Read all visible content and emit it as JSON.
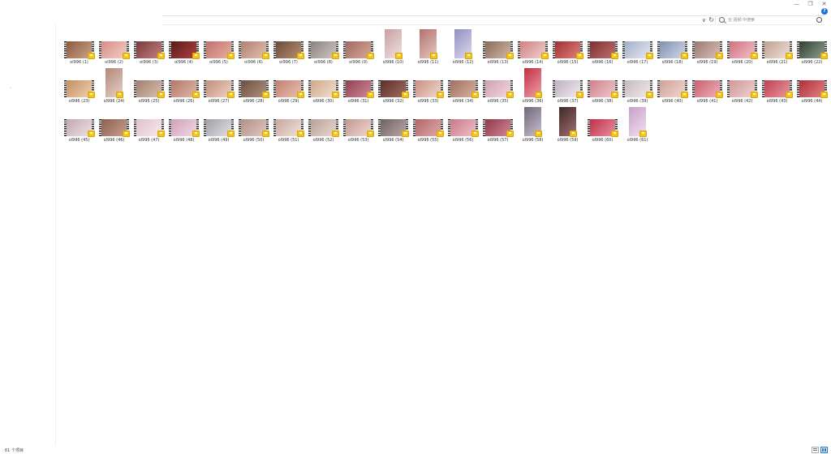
{
  "window": {
    "controls": [
      "minimize-icon",
      "maximize-icon",
      "close-icon"
    ],
    "minimize_glyph": "—",
    "maximize_glyph": "❐",
    "close_glyph": "✕",
    "help_glyph": "?"
  },
  "address_bar": {
    "chevron_glyph": "∨",
    "refresh_glyph": "↻",
    "search_placeholder": "在 视频 中搜索"
  },
  "files": [
    {
      "name": "ol996 (1)",
      "orientation": "landscape",
      "palette": [
        "#8b5a3c",
        "#c9a58a"
      ]
    },
    {
      "name": "ol996 (2)",
      "orientation": "landscape",
      "palette": [
        "#d98c8c",
        "#f0d0c0"
      ]
    },
    {
      "name": "ol996 (3)",
      "orientation": "landscape",
      "palette": [
        "#7a3a3a",
        "#c48080"
      ]
    },
    {
      "name": "ol996 (4)",
      "orientation": "landscape",
      "palette": [
        "#5a1a1a",
        "#b04040"
      ]
    },
    {
      "name": "ol996 (5)",
      "orientation": "landscape",
      "palette": [
        "#c07070",
        "#e8b0a0"
      ]
    },
    {
      "name": "ol996 (6)",
      "orientation": "landscape",
      "palette": [
        "#b08070",
        "#e0c0b0"
      ]
    },
    {
      "name": "ol996 (7)",
      "orientation": "landscape",
      "palette": [
        "#6a4a3a",
        "#b89070"
      ]
    },
    {
      "name": "ol996 (8)",
      "orientation": "landscape",
      "palette": [
        "#8a8080",
        "#d0c8c0"
      ]
    },
    {
      "name": "ol996 (9)",
      "orientation": "landscape",
      "palette": [
        "#a06a60",
        "#d8a898"
      ]
    },
    {
      "name": "ol996 (10)",
      "orientation": "portrait",
      "palette": [
        "#c8a0a0",
        "#f0e0e0"
      ]
    },
    {
      "name": "ol996 (11)",
      "orientation": "portrait",
      "palette": [
        "#b07070",
        "#e8c8c0"
      ]
    },
    {
      "name": "ol996 (12)",
      "orientation": "portrait",
      "palette": [
        "#9090c0",
        "#e0d8f0"
      ]
    },
    {
      "name": "ol996 (13)",
      "orientation": "landscape",
      "palette": [
        "#8a6a5a",
        "#d0b8a8"
      ]
    },
    {
      "name": "ol996 (14)",
      "orientation": "landscape",
      "palette": [
        "#d08080",
        "#f0d0d0"
      ]
    },
    {
      "name": "ol996 (15)",
      "orientation": "landscape",
      "palette": [
        "#a03030",
        "#e08080"
      ]
    },
    {
      "name": "ol996 (16)",
      "orientation": "landscape",
      "palette": [
        "#7a3030",
        "#c07070"
      ]
    },
    {
      "name": "ol996 (17)",
      "orientation": "landscape",
      "palette": [
        "#a0b0c8",
        "#e8e8f0"
      ]
    },
    {
      "name": "ol996 (18)",
      "orientation": "landscape",
      "palette": [
        "#8090b0",
        "#d0d8e8"
      ]
    },
    {
      "name": "ol996 (19)",
      "orientation": "landscape",
      "palette": [
        "#9a7a70",
        "#d8c0b8"
      ]
    },
    {
      "name": "ol996 (20)",
      "orientation": "landscape",
      "palette": [
        "#d07080",
        "#f0c0c8"
      ]
    },
    {
      "name": "ol996 (21)",
      "orientation": "landscape",
      "palette": [
        "#c0a090",
        "#f0e0d8"
      ]
    },
    {
      "name": "ol996 (22)",
      "orientation": "landscape",
      "palette": [
        "#304030",
        "#90a090"
      ]
    },
    {
      "name": "ol996 (23)",
      "orientation": "landscape",
      "palette": [
        "#c09060",
        "#f0d0b0"
      ]
    },
    {
      "name": "ol996 (24)",
      "orientation": "portrait",
      "palette": [
        "#b08878",
        "#e8d0c8"
      ]
    },
    {
      "name": "ol996 (25)",
      "orientation": "landscape",
      "palette": [
        "#a08070",
        "#d8c0b0"
      ]
    },
    {
      "name": "ol996 (26)",
      "orientation": "landscape",
      "palette": [
        "#b07868",
        "#e0b8a8"
      ]
    },
    {
      "name": "ol996 (27)",
      "orientation": "landscape",
      "palette": [
        "#c09080",
        "#f0d0c0"
      ]
    },
    {
      "name": "ol996 (28)",
      "orientation": "landscape",
      "palette": [
        "#6a5040",
        "#b09080"
      ]
    },
    {
      "name": "ol996 (29)",
      "orientation": "landscape",
      "palette": [
        "#c08070",
        "#e8c0b0"
      ]
    },
    {
      "name": "ol996 (30)",
      "orientation": "landscape",
      "palette": [
        "#d0a888",
        "#f0e0d0"
      ]
    },
    {
      "name": "ol996 (31)",
      "orientation": "landscape",
      "palette": [
        "#904050",
        "#d08898"
      ]
    },
    {
      "name": "ol996 (32)",
      "orientation": "landscape",
      "palette": [
        "#5a3028",
        "#a06a60"
      ]
    },
    {
      "name": "ol996 (33)",
      "orientation": "landscape",
      "palette": [
        "#c89080",
        "#f0d8d0"
      ]
    },
    {
      "name": "ol996 (34)",
      "orientation": "landscape",
      "palette": [
        "#a07060",
        "#d8b0a0"
      ]
    },
    {
      "name": "ol996 (35)",
      "orientation": "landscape",
      "palette": [
        "#d0a0b0",
        "#f0d8e0"
      ]
    },
    {
      "name": "ol996 (36)",
      "orientation": "portrait",
      "palette": [
        "#c03040",
        "#f0a0b0"
      ]
    },
    {
      "name": "ol996 (37)",
      "orientation": "landscape",
      "palette": [
        "#c0b0c0",
        "#f0e8f0"
      ]
    },
    {
      "name": "ol996 (38)",
      "orientation": "landscape",
      "palette": [
        "#d08088",
        "#f0c8d0"
      ]
    },
    {
      "name": "ol996 (39)",
      "orientation": "landscape",
      "palette": [
        "#c8b8c0",
        "#f0e8ec"
      ]
    },
    {
      "name": "ol996 (40)",
      "orientation": "landscape",
      "palette": [
        "#d0a098",
        "#f0d8d0"
      ]
    },
    {
      "name": "ol996 (41)",
      "orientation": "landscape",
      "palette": [
        "#c86070",
        "#f0b0b8"
      ]
    },
    {
      "name": "ol996 (42)",
      "orientation": "landscape",
      "palette": [
        "#d09898",
        "#f0d0d0"
      ]
    },
    {
      "name": "ol996 (43)",
      "orientation": "landscape",
      "palette": [
        "#c04050",
        "#e898a0"
      ]
    },
    {
      "name": "ol996 (44)",
      "orientation": "landscape",
      "palette": [
        "#b03038",
        "#e08088"
      ]
    },
    {
      "name": "ol996 (45)",
      "orientation": "landscape",
      "palette": [
        "#c0a8b0",
        "#f0e0e8"
      ]
    },
    {
      "name": "ol996 (46)",
      "orientation": "landscape",
      "palette": [
        "#8a6050",
        "#c8a090"
      ]
    },
    {
      "name": "ol996 (47)",
      "orientation": "landscape",
      "palette": [
        "#e0c0c8",
        "#f8eaee"
      ]
    },
    {
      "name": "ol996 (48)",
      "orientation": "landscape",
      "palette": [
        "#d0a0b8",
        "#f0d8e4"
      ]
    },
    {
      "name": "ol996 (49)",
      "orientation": "landscape",
      "palette": [
        "#a0a0a8",
        "#e0e0e4"
      ]
    },
    {
      "name": "ol996 (50)",
      "orientation": "landscape",
      "palette": [
        "#b09088",
        "#e0c8c0"
      ]
    },
    {
      "name": "ol996 (51)",
      "orientation": "landscape",
      "palette": [
        "#c8a8a0",
        "#f0e0d8"
      ]
    },
    {
      "name": "ol996 (52)",
      "orientation": "landscape",
      "palette": [
        "#b8a098",
        "#e8d8d0"
      ]
    },
    {
      "name": "ol996 (53)",
      "orientation": "landscape",
      "palette": [
        "#c09890",
        "#f0d8d0"
      ]
    },
    {
      "name": "ol996 (54)",
      "orientation": "landscape",
      "palette": [
        "#706060",
        "#b8a8a8"
      ]
    },
    {
      "name": "ol996 (55)",
      "orientation": "landscape",
      "palette": [
        "#b06868",
        "#e0a8a8"
      ]
    },
    {
      "name": "ol996 (56)",
      "orientation": "landscape",
      "palette": [
        "#c87888",
        "#f0c0c8"
      ]
    },
    {
      "name": "ol996 (57)",
      "orientation": "landscape",
      "palette": [
        "#903848",
        "#d08898"
      ]
    },
    {
      "name": "ol996 (58)",
      "orientation": "portrait",
      "palette": [
        "#706878",
        "#c8c0d0"
      ]
    },
    {
      "name": "ol996 (59)",
      "orientation": "portrait",
      "palette": [
        "#402828",
        "#a07070"
      ]
    },
    {
      "name": "ol996 (60)",
      "orientation": "landscape",
      "palette": [
        "#c03048",
        "#e890a0"
      ]
    },
    {
      "name": "ol996 (61)",
      "orientation": "portrait",
      "palette": [
        "#c8a0c8",
        "#f0e0f0"
      ]
    }
  ],
  "status_bar": {
    "item_count": "61 个项目",
    "view_buttons": [
      "details-icon",
      "tiles-icon"
    ]
  },
  "colors": {
    "badge": "#f4c51a",
    "selection_blue": "#2b79d0"
  }
}
